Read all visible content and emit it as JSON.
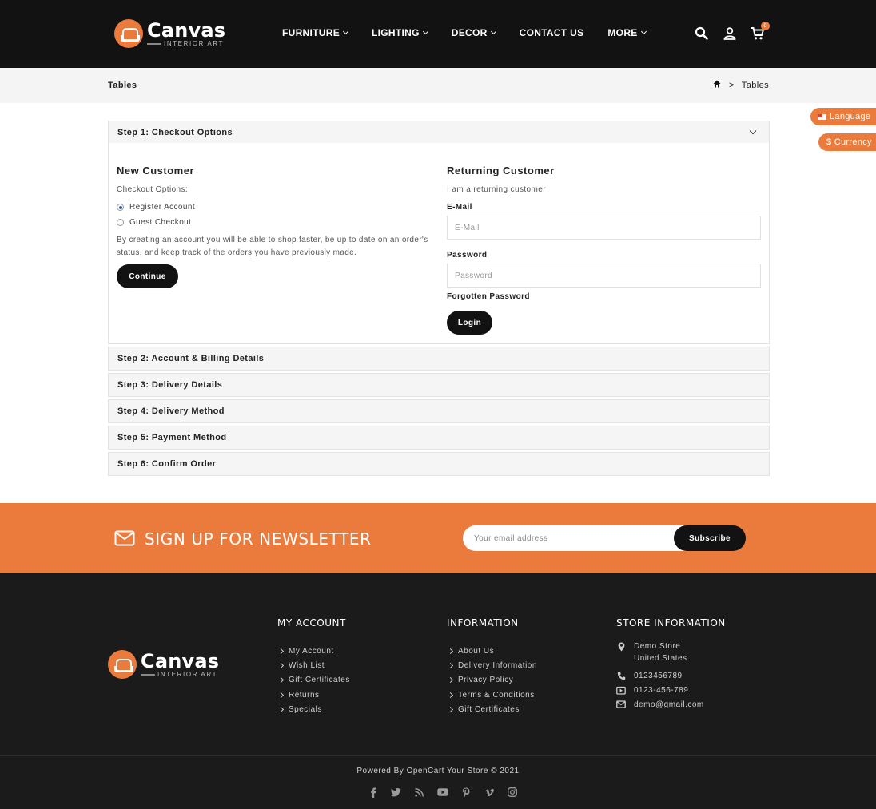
{
  "brand": {
    "name": "Canvas",
    "tagline": "INTERIOR ART"
  },
  "nav": {
    "items": [
      {
        "label": "FURNITURE",
        "dropdown": true
      },
      {
        "label": "LIGHTING",
        "dropdown": true
      },
      {
        "label": "DECOR",
        "dropdown": true
      },
      {
        "label": "CONTACT US",
        "dropdown": false
      },
      {
        "label": "MORE",
        "dropdown": true
      }
    ],
    "icons": [
      "search-icon",
      "user-icon",
      "cart-icon"
    ],
    "cart_count": "0"
  },
  "page": {
    "title": "Tables",
    "breadcrumb": {
      "home_icon": "home-icon",
      "separator": ">",
      "current": "Tables"
    }
  },
  "side_tabs": {
    "language": "Language",
    "currency": "$ Currency"
  },
  "checkout": {
    "steps": [
      "Step 1: Checkout Options",
      "Step 2: Account & Billing Details",
      "Step 3: Delivery Details",
      "Step 4: Delivery Method",
      "Step 5: Payment Method",
      "Step 6: Confirm Order"
    ],
    "new_customer": {
      "heading": "New Customer",
      "options_label": "Checkout Options:",
      "options": [
        {
          "label": "Register Account",
          "checked": true
        },
        {
          "label": "Guest Checkout",
          "checked": false
        }
      ],
      "description": "By creating an account you will be able to shop faster, be up to date on an order's status, and keep track of the orders you have previously made.",
      "continue_label": "Continue"
    },
    "returning_customer": {
      "heading": "Returning Customer",
      "subtitle": "I am a returning customer",
      "email_label": "E-Mail",
      "email_placeholder": "E-Mail",
      "password_label": "Password",
      "password_placeholder": "Password",
      "forgotten_label": "Forgotten Password",
      "login_label": "Login"
    }
  },
  "newsletter": {
    "title": "SIGN UP FOR NEWSLETTER",
    "placeholder": "Your email address",
    "button": "Subscribe"
  },
  "footer": {
    "my_account": {
      "heading": "MY ACCOUNT",
      "links": [
        "My Account",
        "Wish List",
        "Gift Certificates",
        "Returns",
        "Specials"
      ]
    },
    "information": {
      "heading": "INFORMATION",
      "links": [
        "About Us",
        "Delivery Information",
        "Privacy Policy",
        "Terms & Conditions",
        "Gift Certificates"
      ]
    },
    "store": {
      "heading": "STORE INFORMATION",
      "address_line1": "Demo Store",
      "address_line2": "United States",
      "phone": "0123456789",
      "fax": "0123-456-789",
      "email": "demo@gmail.com"
    },
    "powered": "Powered By OpenCart Your Store © 2021",
    "socials": [
      "facebook-icon",
      "twitter-icon",
      "rss-icon",
      "youtube-icon",
      "pinterest-icon",
      "vimeo-icon",
      "instagram-icon"
    ]
  },
  "colors": {
    "accent": "#ea7b3c",
    "dark": "#121212",
    "footer_bg": "#1b1b1b",
    "panel_bg": "#f5f5f5"
  }
}
